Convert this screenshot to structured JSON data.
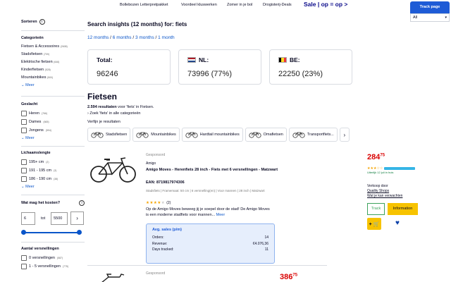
{
  "promo": {
    "links": [
      "Bollebozen Letterpretpakket",
      "Voordeel kluswerken",
      "Zomer in je bol",
      "Drogisterij-Deals"
    ],
    "sale": "Sale | op = op >"
  },
  "extension": {
    "track_button": "Track page",
    "select_value": "All"
  },
  "sidebar": {
    "sort_label": "Sorteren",
    "categories_title": "Categorieën",
    "categories": [
      {
        "label": "Fietsen & Accessoires",
        "count": "(2608)"
      },
      {
        "label": "Stadsfietsen",
        "count": "(709)"
      },
      {
        "label": "Elektrische fietsen",
        "count": "(646)"
      },
      {
        "label": "Kinderfietsen",
        "count": "(528)"
      },
      {
        "label": "Mountainbikes",
        "count": "(500)"
      }
    ],
    "more": "Meer",
    "gender_title": "Geslacht",
    "gender": [
      {
        "label": "Heren",
        "count": "(766)"
      },
      {
        "label": "Dames",
        "count": "(665)"
      },
      {
        "label": "Jongens",
        "count": "(594)"
      }
    ],
    "height_title": "Lichaamslengte",
    "heights": [
      {
        "label": "195+ cm",
        "count": "(2)"
      },
      {
        "label": "191 - 195 cm",
        "count": "(3)"
      },
      {
        "label": "186 - 190 cm",
        "count": "(38)"
      }
    ],
    "price_title": "Wat mag het kosten?",
    "price_min": "6",
    "price_to": "tot",
    "price_max": "5500",
    "price_range_fraction": [
      0.0,
      1.0
    ],
    "gears_title": "Aantal versnellingen",
    "gears": [
      {
        "label": "0 versnellingen",
        "count": "(587)"
      },
      {
        "label": "1 - 5 versnellingen",
        "count": "(775)"
      }
    ]
  },
  "main": {
    "search_title": "Search insights (12 months) for: fiets",
    "periods": [
      "12 months",
      "6 months",
      "3 months",
      "1 month"
    ],
    "stats": [
      {
        "label": "Total:",
        "value": "96246",
        "flag": ""
      },
      {
        "label": "NL:",
        "value": "73996 (77%)",
        "flag": "nl"
      },
      {
        "label": "BE:",
        "value": "22250 (23%)",
        "flag": "be"
      }
    ],
    "category_heading": "Fietsen",
    "results_count": "2.594 resultaten",
    "results_text": " voor 'fiets' in Fietsen.",
    "zoek_text": "Zoek 'fiets' in alle categorieën",
    "refine": "Verfijn je resultaten",
    "chips": [
      "Stadsfietsen",
      "Mountainbikes",
      "Hardtail mountainbikes",
      "Omafietsen",
      "Transportfiets..."
    ]
  },
  "product": {
    "sponsored": "Gesponsord",
    "brand": "Amigo",
    "title": "Amigo Moves - Herenfiets 28 inch - Fiets met 6 versnellingen - Matzwart",
    "ean": "EAN: 8719817974306",
    "specs": "Stadsfiets | Framemaat: 50 cm | 6 versnelling(en) | Voor mannen | 28 inch | Matzwart",
    "rating_stars": 4,
    "rating_count": "(2)",
    "description": "Op de Amigo Moves beweeg jij je soepel door de stad! De Amigo Moves is een moderne stadfiets voor mannen...",
    "more": "Meer",
    "sales_title": "Avg. sales (p/m)",
    "sales_rows": [
      {
        "label": "Orders:",
        "value": "14"
      },
      {
        "label": "Revenue:",
        "value": "€4.076,36"
      },
      {
        "label": "Days tracked:",
        "value": "11"
      }
    ],
    "price_main": "284",
    "price_cents": "75",
    "delivery": "Uiterlijk 12 juli in huis",
    "seller_label": "Verkoop door",
    "seller": "Quality Shops",
    "seller_link": "Wat je kan verwachten",
    "track_label": "Track",
    "info_label": "Information",
    "cart_label": "+ 🛒"
  },
  "product2": {
    "sponsored": "Gesponsord",
    "price_main": "386",
    "price_cents": "75"
  },
  "colors": {
    "accent": "#0a55c9",
    "price": "#d90000",
    "cta": "#f7c300",
    "track_green": "#3da35d",
    "sales_bg": "#e6eefc"
  }
}
